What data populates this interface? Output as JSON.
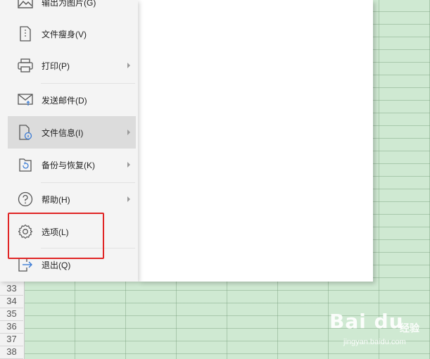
{
  "menu": {
    "items": [
      {
        "label": "输出为图片(G)",
        "icon": "image-export-icon",
        "has_arrow": false
      },
      {
        "label": "文件瘦身(V)",
        "icon": "file-slim-icon",
        "has_arrow": false
      },
      {
        "label": "打印(P)",
        "icon": "printer-icon",
        "has_arrow": true
      },
      {
        "label": "发送邮件(D)",
        "icon": "mail-icon",
        "has_arrow": false
      },
      {
        "label": "文件信息(I)",
        "icon": "file-info-icon",
        "has_arrow": true
      },
      {
        "label": "备份与恢复(K)",
        "icon": "backup-restore-icon",
        "has_arrow": true
      },
      {
        "label": "帮助(H)",
        "icon": "help-icon",
        "has_arrow": true
      },
      {
        "label": "选项(L)",
        "icon": "gear-icon",
        "has_arrow": false
      },
      {
        "label": "退出(Q)",
        "icon": "exit-icon",
        "has_arrow": false
      }
    ],
    "active_item": "文件信息(I)",
    "highlighted_item": "选项(L)"
  },
  "sheet": {
    "row_numbers": [
      "33",
      "34",
      "35",
      "36",
      "37",
      "38"
    ]
  },
  "watermark": {
    "logo": "Bai du",
    "cn": "经验",
    "url": "jingyan.baidu.com"
  },
  "colors": {
    "highlight": "#e02424",
    "sheet_bg": "#cfe9d2",
    "panel_bg": "#f4f4f4",
    "active_bg": "#dcdcdc"
  }
}
